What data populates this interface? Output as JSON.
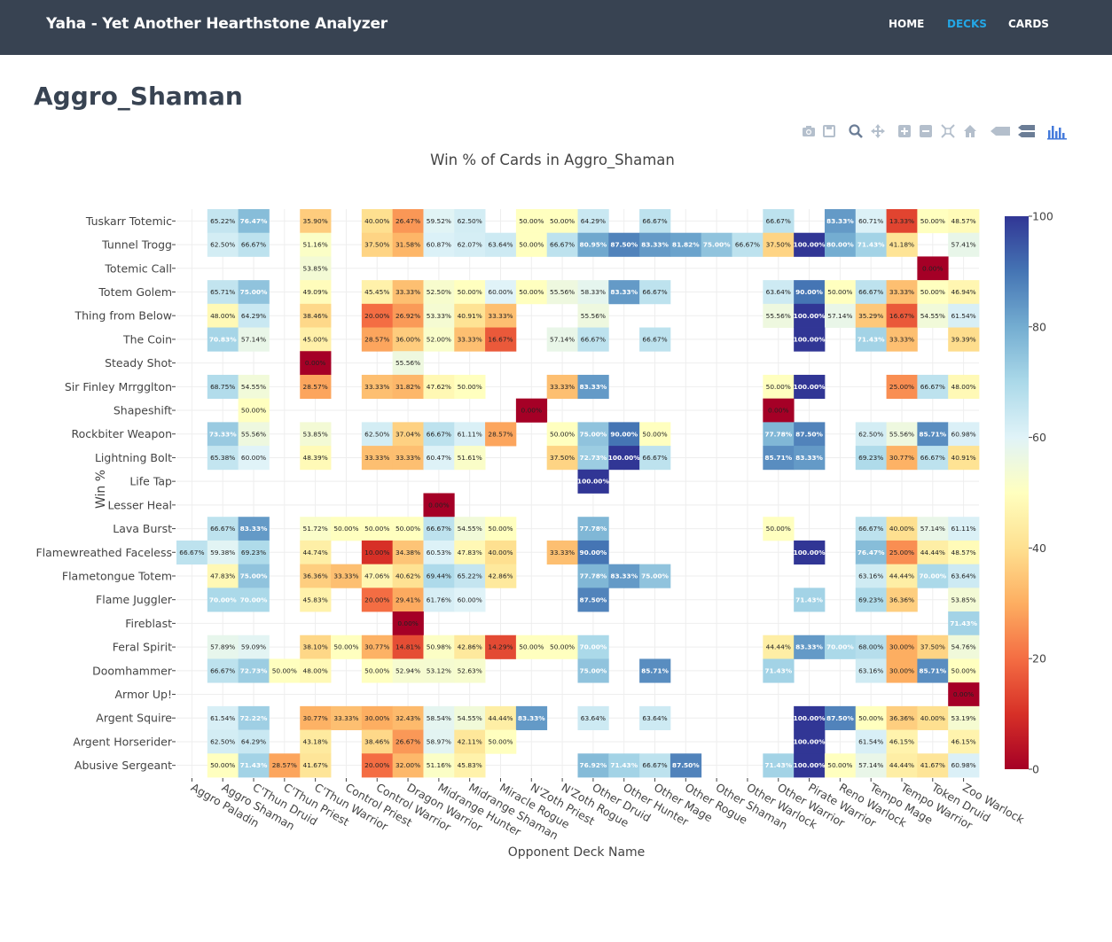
{
  "navbar": {
    "brand": "Yaha - Yet Another Hearthstone Analyzer",
    "links": [
      {
        "label": "HOME",
        "active": false
      },
      {
        "label": "DECKS",
        "active": true
      },
      {
        "label": "CARDS",
        "active": false
      }
    ],
    "bg_color": "#384352",
    "active_color": "#23a7e6"
  },
  "page": {
    "title": "Aggro_Shaman"
  },
  "modebar": {
    "buttons": [
      "camera-icon",
      "save-icon",
      "zoom-icon",
      "pan-icon",
      "zoom-in-icon",
      "zoom-out-icon",
      "autoscale-icon",
      "home-icon",
      "hover-closest-icon",
      "hover-compare-icon",
      "plotly-logo-icon"
    ]
  },
  "chart_data": {
    "type": "heatmap",
    "title": "Win % of Cards in Aggro_Shaman",
    "xlabel": "Opponent Deck Name",
    "ylabel": "Win %",
    "x": [
      "Aggro Paladin",
      "Aggro Shaman",
      "C'Thun Druid",
      "C'Thun Priest",
      "C'Thun Warrior",
      "Control Priest",
      "Control Warrior",
      "Dragon Warrior",
      "Midrange Hunter",
      "Midrange Shaman",
      "Miracle Rogue",
      "N'Zoth Priest",
      "N'Zoth Rogue",
      "Other Druid",
      "Other Hunter",
      "Other Mage",
      "Other Rogue",
      "Other Shaman",
      "Other Warlock",
      "Other Warrior",
      "Pirate Warrior",
      "Reno Warlock",
      "Tempo Mage",
      "Tempo Warrior",
      "Token Druid",
      "Zoo Warlock"
    ],
    "y": [
      "Tuskarr Totemic",
      "Tunnel Trogg",
      "Totemic Call",
      "Totem Golem",
      "Thing from Below",
      "The Coin",
      "Steady Shot",
      "Sir Finley Mrrgglton",
      "Shapeshift",
      "Rockbiter Weapon",
      "Lightning Bolt",
      "Life Tap",
      "Lesser Heal",
      "Lava Burst",
      "Flamewreathed Faceless",
      "Flametongue Totem",
      "Flame Juggler",
      "Fireblast",
      "Feral Spirit",
      "Doomhammer",
      "Armor Up!",
      "Argent Squire",
      "Argent Horserider",
      "Abusive Sergeant"
    ],
    "z": [
      [
        null,
        65.22,
        76.47,
        null,
        35.9,
        null,
        40.0,
        26.47,
        59.52,
        62.5,
        null,
        50.0,
        50.0,
        64.29,
        null,
        66.67,
        null,
        null,
        null,
        66.67,
        null,
        83.33,
        60.71,
        13.33,
        50.0,
        48.57
      ],
      [
        null,
        62.5,
        66.67,
        null,
        51.16,
        null,
        37.5,
        31.58,
        60.87,
        62.07,
        63.64,
        50.0,
        66.67,
        80.95,
        87.5,
        83.33,
        81.82,
        75.0,
        66.67,
        37.5,
        100.0,
        80.0,
        71.43,
        41.18,
        null,
        57.41
      ],
      [
        null,
        null,
        null,
        null,
        53.85,
        null,
        null,
        null,
        null,
        null,
        null,
        null,
        null,
        null,
        null,
        null,
        null,
        null,
        null,
        null,
        null,
        null,
        null,
        null,
        0.0,
        null
      ],
      [
        null,
        65.71,
        75.0,
        null,
        49.09,
        null,
        45.45,
        33.33,
        52.5,
        50.0,
        60.0,
        50.0,
        55.56,
        58.33,
        83.33,
        66.67,
        null,
        null,
        null,
        63.64,
        90.0,
        50.0,
        66.67,
        33.33,
        50.0,
        46.94
      ],
      [
        null,
        48.0,
        64.29,
        null,
        38.46,
        null,
        20.0,
        26.92,
        53.33,
        40.91,
        33.33,
        null,
        null,
        55.56,
        null,
        null,
        null,
        null,
        null,
        55.56,
        100.0,
        57.14,
        35.29,
        16.67,
        54.55,
        61.54
      ],
      [
        null,
        70.83,
        57.14,
        null,
        45.0,
        null,
        28.57,
        36.0,
        52.0,
        33.33,
        16.67,
        null,
        57.14,
        66.67,
        null,
        66.67,
        null,
        null,
        null,
        null,
        100.0,
        null,
        71.43,
        33.33,
        null,
        39.39
      ],
      [
        null,
        null,
        null,
        null,
        0.0,
        null,
        null,
        55.56,
        null,
        null,
        null,
        null,
        null,
        null,
        null,
        null,
        null,
        null,
        null,
        null,
        null,
        null,
        null,
        null,
        null,
        null
      ],
      [
        null,
        68.75,
        54.55,
        null,
        28.57,
        null,
        33.33,
        31.82,
        47.62,
        50.0,
        null,
        null,
        33.33,
        83.33,
        null,
        null,
        null,
        null,
        null,
        50.0,
        100.0,
        null,
        null,
        25.0,
        66.67,
        48.0
      ],
      [
        null,
        null,
        50.0,
        null,
        null,
        null,
        null,
        null,
        null,
        null,
        null,
        0.0,
        null,
        null,
        null,
        null,
        null,
        null,
        null,
        0.0,
        null,
        null,
        null,
        null,
        null,
        null
      ],
      [
        null,
        73.33,
        55.56,
        null,
        53.85,
        null,
        62.5,
        37.04,
        66.67,
        61.11,
        28.57,
        null,
        50.0,
        75.0,
        90.0,
        50.0,
        null,
        null,
        null,
        77.78,
        87.5,
        null,
        62.5,
        55.56,
        85.71,
        60.98
      ],
      [
        null,
        65.38,
        60.0,
        null,
        48.39,
        null,
        33.33,
        33.33,
        60.47,
        51.61,
        null,
        null,
        37.5,
        72.73,
        100.0,
        66.67,
        null,
        null,
        null,
        85.71,
        83.33,
        null,
        69.23,
        30.77,
        66.67,
        40.91
      ],
      [
        null,
        null,
        null,
        null,
        null,
        null,
        null,
        null,
        null,
        null,
        null,
        null,
        null,
        100.0,
        null,
        null,
        null,
        null,
        null,
        null,
        null,
        null,
        null,
        null,
        null,
        null
      ],
      [
        null,
        null,
        null,
        null,
        null,
        null,
        null,
        null,
        0.0,
        null,
        null,
        null,
        null,
        null,
        null,
        null,
        null,
        null,
        null,
        null,
        null,
        null,
        null,
        null,
        null,
        null
      ],
      [
        null,
        66.67,
        83.33,
        null,
        51.72,
        50.0,
        50.0,
        50.0,
        66.67,
        54.55,
        50.0,
        null,
        null,
        77.78,
        null,
        null,
        null,
        null,
        null,
        50.0,
        null,
        null,
        66.67,
        40.0,
        57.14,
        61.11
      ],
      [
        66.67,
        59.38,
        69.23,
        null,
        44.74,
        null,
        10.0,
        34.38,
        60.53,
        47.83,
        40.0,
        null,
        33.33,
        90.0,
        null,
        null,
        null,
        null,
        null,
        null,
        100.0,
        null,
        76.47,
        25.0,
        44.44,
        48.57
      ],
      [
        null,
        47.83,
        75.0,
        null,
        36.36,
        33.33,
        47.06,
        40.62,
        69.44,
        65.22,
        42.86,
        null,
        null,
        77.78,
        83.33,
        75.0,
        null,
        null,
        null,
        null,
        null,
        null,
        63.16,
        44.44,
        70.0,
        63.64
      ],
      [
        null,
        70.0,
        70.0,
        null,
        45.83,
        null,
        20.0,
        29.41,
        61.76,
        60.0,
        null,
        null,
        null,
        87.5,
        null,
        null,
        null,
        null,
        null,
        null,
        71.43,
        null,
        69.23,
        36.36,
        null,
        53.85
      ],
      [
        null,
        null,
        null,
        null,
        null,
        null,
        null,
        0.0,
        null,
        null,
        null,
        null,
        null,
        null,
        null,
        null,
        null,
        null,
        null,
        null,
        null,
        null,
        null,
        null,
        null,
        71.43
      ],
      [
        null,
        57.89,
        59.09,
        null,
        38.1,
        50.0,
        30.77,
        14.81,
        50.98,
        42.86,
        14.29,
        50.0,
        50.0,
        70.0,
        null,
        null,
        null,
        null,
        null,
        44.44,
        83.33,
        70.0,
        68.0,
        30.0,
        37.5,
        54.76
      ],
      [
        null,
        66.67,
        72.73,
        50.0,
        48.0,
        null,
        50.0,
        52.94,
        53.12,
        52.63,
        null,
        null,
        null,
        75.0,
        null,
        85.71,
        null,
        null,
        null,
        71.43,
        null,
        null,
        63.16,
        30.0,
        85.71,
        50.0
      ],
      [
        null,
        null,
        null,
        null,
        null,
        null,
        null,
        null,
        null,
        null,
        null,
        null,
        null,
        null,
        null,
        null,
        null,
        null,
        null,
        null,
        null,
        null,
        null,
        null,
        null,
        0.0
      ],
      [
        null,
        61.54,
        72.22,
        null,
        30.77,
        33.33,
        30.0,
        32.43,
        58.54,
        54.55,
        44.44,
        83.33,
        null,
        63.64,
        null,
        63.64,
        null,
        null,
        null,
        null,
        100.0,
        87.5,
        50.0,
        36.36,
        40.0,
        53.19
      ],
      [
        null,
        62.5,
        64.29,
        null,
        43.18,
        null,
        38.46,
        26.67,
        58.97,
        42.11,
        50.0,
        null,
        null,
        null,
        null,
        null,
        null,
        null,
        null,
        null,
        100.0,
        null,
        61.54,
        46.15,
        null,
        46.15
      ],
      [
        null,
        50.0,
        71.43,
        28.57,
        41.67,
        null,
        20.0,
        32.0,
        51.16,
        45.83,
        null,
        null,
        null,
        76.92,
        71.43,
        66.67,
        87.5,
        null,
        null,
        71.43,
        100.0,
        50.0,
        57.14,
        44.44,
        41.67,
        60.98
      ]
    ],
    "zmin": 0,
    "zmax": 100,
    "colorscale": "RdYlBu",
    "colorbar_ticks": [
      "0",
      "20",
      "40",
      "60",
      "80",
      "100"
    ],
    "grid": true
  }
}
